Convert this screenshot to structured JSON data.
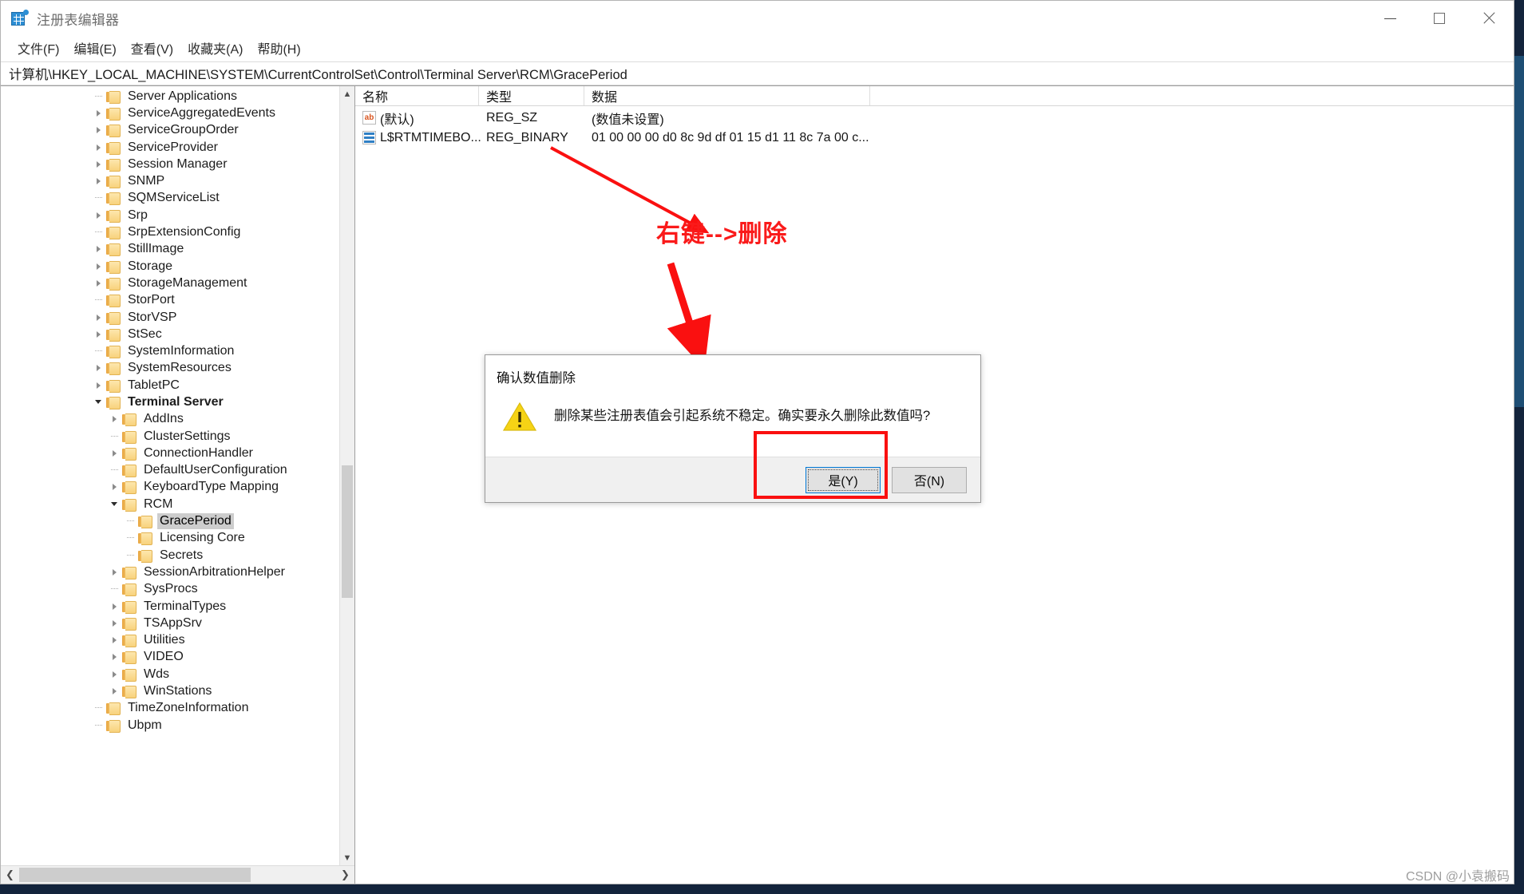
{
  "window": {
    "title": "注册表编辑器",
    "icon": "registry-editor-icon",
    "controls": {
      "minimize": "minimize-icon",
      "maximize": "maximize-icon",
      "close": "close-icon"
    }
  },
  "menubar": {
    "items": [
      {
        "label": "文件(F)",
        "name": "menu-file"
      },
      {
        "label": "编辑(E)",
        "name": "menu-edit"
      },
      {
        "label": "查看(V)",
        "name": "menu-view"
      },
      {
        "label": "收藏夹(A)",
        "name": "menu-favorites"
      },
      {
        "label": "帮助(H)",
        "name": "menu-help"
      }
    ]
  },
  "address": {
    "path": "计算机\\HKEY_LOCAL_MACHINE\\SYSTEM\\CurrentControlSet\\Control\\Terminal Server\\RCM\\GracePeriod"
  },
  "tree": {
    "items": [
      {
        "label": "Server Applications",
        "depth": 1,
        "state": "leaf"
      },
      {
        "label": "ServiceAggregatedEvents",
        "depth": 1,
        "state": "collapsed"
      },
      {
        "label": "ServiceGroupOrder",
        "depth": 1,
        "state": "collapsed"
      },
      {
        "label": "ServiceProvider",
        "depth": 1,
        "state": "collapsed"
      },
      {
        "label": "Session Manager",
        "depth": 1,
        "state": "collapsed"
      },
      {
        "label": "SNMP",
        "depth": 1,
        "state": "collapsed"
      },
      {
        "label": "SQMServiceList",
        "depth": 1,
        "state": "leaf"
      },
      {
        "label": "Srp",
        "depth": 1,
        "state": "collapsed"
      },
      {
        "label": "SrpExtensionConfig",
        "depth": 1,
        "state": "leaf"
      },
      {
        "label": "StillImage",
        "depth": 1,
        "state": "collapsed"
      },
      {
        "label": "Storage",
        "depth": 1,
        "state": "collapsed"
      },
      {
        "label": "StorageManagement",
        "depth": 1,
        "state": "collapsed"
      },
      {
        "label": "StorPort",
        "depth": 1,
        "state": "leaf"
      },
      {
        "label": "StorVSP",
        "depth": 1,
        "state": "collapsed"
      },
      {
        "label": "StSec",
        "depth": 1,
        "state": "collapsed"
      },
      {
        "label": "SystemInformation",
        "depth": 1,
        "state": "leaf"
      },
      {
        "label": "SystemResources",
        "depth": 1,
        "state": "collapsed"
      },
      {
        "label": "TabletPC",
        "depth": 1,
        "state": "collapsed"
      },
      {
        "label": "Terminal Server",
        "depth": 1,
        "state": "expanded",
        "bold": true
      },
      {
        "label": "AddIns",
        "depth": 2,
        "state": "collapsed"
      },
      {
        "label": "ClusterSettings",
        "depth": 2,
        "state": "leaf"
      },
      {
        "label": "ConnectionHandler",
        "depth": 2,
        "state": "collapsed"
      },
      {
        "label": "DefaultUserConfiguration",
        "depth": 2,
        "state": "leaf"
      },
      {
        "label": "KeyboardType Mapping",
        "depth": 2,
        "state": "collapsed"
      },
      {
        "label": "RCM",
        "depth": 2,
        "state": "expanded"
      },
      {
        "label": "GracePeriod",
        "depth": 3,
        "state": "leaf",
        "selected": true
      },
      {
        "label": "Licensing Core",
        "depth": 3,
        "state": "leaf"
      },
      {
        "label": "Secrets",
        "depth": 3,
        "state": "leaf"
      },
      {
        "label": "SessionArbitrationHelper",
        "depth": 2,
        "state": "collapsed"
      },
      {
        "label": "SysProcs",
        "depth": 2,
        "state": "leaf"
      },
      {
        "label": "TerminalTypes",
        "depth": 2,
        "state": "collapsed"
      },
      {
        "label": "TSAppSrv",
        "depth": 2,
        "state": "collapsed"
      },
      {
        "label": "Utilities",
        "depth": 2,
        "state": "collapsed"
      },
      {
        "label": "VIDEO",
        "depth": 2,
        "state": "collapsed"
      },
      {
        "label": "Wds",
        "depth": 2,
        "state": "collapsed"
      },
      {
        "label": "WinStations",
        "depth": 2,
        "state": "collapsed"
      },
      {
        "label": "TimeZoneInformation",
        "depth": 1,
        "state": "leaf"
      },
      {
        "label": "Ubpm",
        "depth": 1,
        "state": "leaf"
      }
    ],
    "scroll_up_icon": "chevron-up-icon",
    "scroll_down_icon": "chevron-down-icon",
    "scroll_left_icon": "chevron-left-icon",
    "scroll_right_icon": "chevron-right-icon"
  },
  "list": {
    "columns": [
      "名称",
      "类型",
      "数据"
    ],
    "rows": [
      {
        "icon": "string-value-icon",
        "name": "(默认)",
        "type": "REG_SZ",
        "data": "(数值未设置)"
      },
      {
        "icon": "binary-value-icon",
        "name": "L$RTMTIMEBO...",
        "type": "REG_BINARY",
        "data": "01 00 00 00 d0 8c 9d df 01 15 d1 11 8c 7a 00 c..."
      }
    ]
  },
  "annotation": {
    "text": "右键-->删除",
    "color": "#fa1a1a"
  },
  "dialog": {
    "title": "确认数值删除",
    "icon": "warning-icon",
    "message": "删除某些注册表值会引起系统不稳定。确实要永久删除此数值吗?",
    "buttons": [
      {
        "label": "是(Y)",
        "name": "yes-button",
        "default": true
      },
      {
        "label": "否(N)",
        "name": "no-button",
        "default": false
      }
    ]
  },
  "watermark": {
    "text": "CSDN @小袁搬码"
  }
}
